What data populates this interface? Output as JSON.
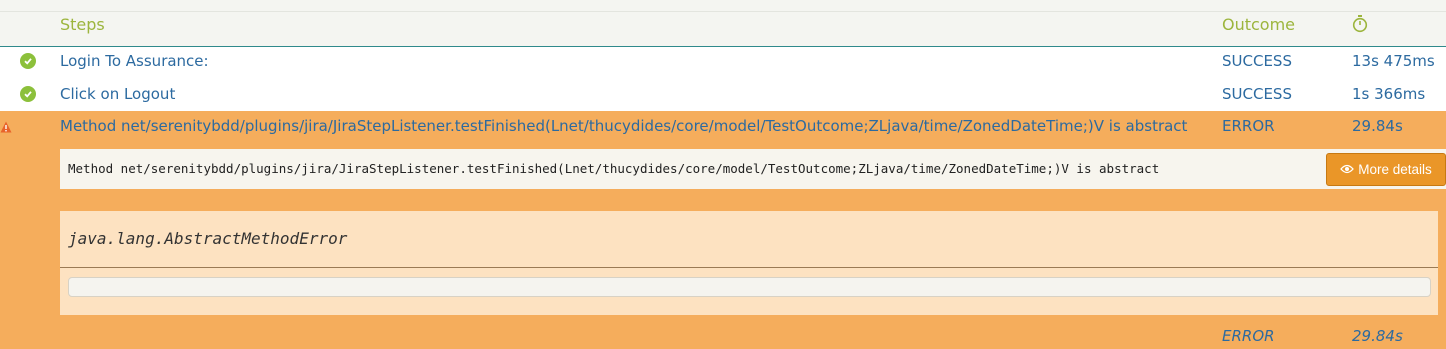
{
  "header": {
    "steps": "Steps",
    "outcome": "Outcome",
    "duration_icon": "stopwatch-icon"
  },
  "rows": [
    {
      "step": "Login To Assurance:",
      "outcome": "SUCCESS",
      "duration": "13s 475ms",
      "status_icon": "success-check-icon"
    },
    {
      "step": "Click on Logout",
      "outcome": "SUCCESS",
      "duration": "1s 366ms",
      "status_icon": "success-check-icon"
    }
  ],
  "error_row": {
    "step": "Method net/serenitybdd/plugins/jira/JiraStepListener.testFinished(Lnet/thucydides/core/model/TestOutcome;ZLjava/time/ZonedDateTime;)V is abstract",
    "outcome": "ERROR",
    "duration": "29.84s",
    "status_icon": "warning-icon",
    "message": "Method net/serenitybdd/plugins/jira/JiraStepListener.testFinished(Lnet/thucydides/core/model/TestOutcome;ZLjava/time/ZonedDateTime;)V is abstract",
    "details_button": "More details",
    "exception": "java.lang.AbstractMethodError",
    "stack_trace": ""
  },
  "footer": {
    "outcome": "ERROR",
    "duration": "29.84s"
  },
  "colors": {
    "accent_green": "#9cb53d",
    "link_blue": "#2c6aa0",
    "error_bg": "#f5ad5c",
    "button_orange": "#ea9628"
  }
}
